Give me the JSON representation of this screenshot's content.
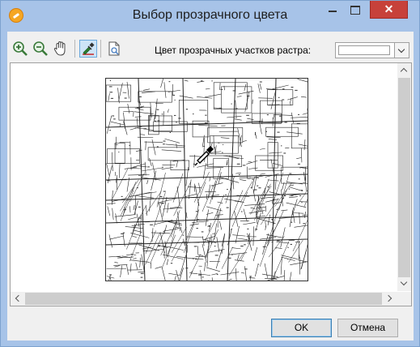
{
  "window": {
    "title": "Выбор прозрачного цвета",
    "close_glyph": "✕"
  },
  "toolbar": {
    "tools": [
      {
        "icon": "zoom-in-icon"
      },
      {
        "icon": "zoom-out-icon"
      },
      {
        "icon": "pan-hand-icon"
      },
      {
        "icon": "eyedropper-icon",
        "active": true
      },
      {
        "icon": "page-view-icon"
      }
    ],
    "transparent_color_label": "Цвет прозрачных участков растра:",
    "transparent_color_value": "#ffffff"
  },
  "viewer": {
    "content": "raster-map",
    "cursor_icon": "eyedropper-icon"
  },
  "buttons": {
    "ok": "OK",
    "cancel": "Отмена"
  },
  "colors": {
    "accent": "#a7c3e8",
    "close": "#c7413a",
    "active_tool": "#cde4f7"
  }
}
